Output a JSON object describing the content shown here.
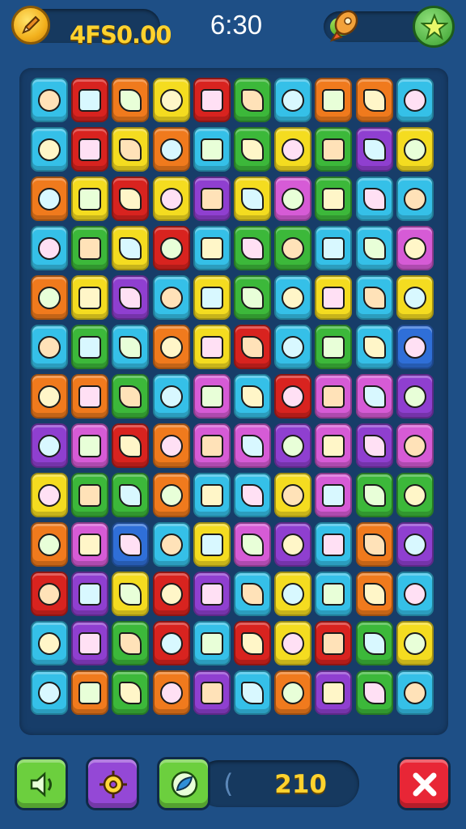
{
  "hud": {
    "coins": "4FS0.00",
    "timer": "6:30",
    "energy_level": 0.22,
    "score": "210"
  },
  "colors": {
    "background": "#1e4f86",
    "board": "#173d69",
    "gold": "#ffd22e"
  },
  "icons": {
    "coin": "pencil-coin-icon",
    "energy": "rocket-icon",
    "bonus": "star-icon",
    "sound": "speaker-icon",
    "settings": "gear-icon",
    "hint": "leaf-icon",
    "close": "close-icon"
  },
  "board": {
    "rows": [
      [
        "#35c0e8",
        "#d8231f",
        "#f07a1d",
        "#f4dc20",
        "#d8231f",
        "#3cb83a",
        "#35c0e8",
        "#f07a1d",
        "#f07a1d",
        "#35c0e8"
      ],
      [
        "#35c0e8",
        "#d8231f",
        "#f4dc20",
        "#f07a1d",
        "#35c0e8",
        "#3cb83a",
        "#f4dc20",
        "#3cb83a",
        "#8f3fd0",
        "#f4dc20"
      ],
      [
        "#f07a1d",
        "#f4dc20",
        "#d8231f",
        "#f4dc20",
        "#8f3fd0",
        "#f4dc20",
        "#d65bd6",
        "#3cb83a",
        "#35c0e8",
        "#35c0e8"
      ],
      [
        "#35c0e8",
        "#3cb83a",
        "#f4dc20",
        "#d8231f",
        "#35c0e8",
        "#3cb83a",
        "#3cb83a",
        "#35c0e8",
        "#35c0e8",
        "#d65bd6"
      ],
      [
        "#f07a1d",
        "#f4dc20",
        "#8f3fd0",
        "#35c0e8",
        "#f4dc20",
        "#3cb83a",
        "#35c0e8",
        "#f4dc20",
        "#35c0e8",
        "#f4dc20"
      ],
      [
        "#35c0e8",
        "#3cb83a",
        "#35c0e8",
        "#f07a1d",
        "#f4dc20",
        "#d8231f",
        "#35c0e8",
        "#3cb83a",
        "#35c0e8",
        "#2f6fd8"
      ],
      [
        "#f07a1d",
        "#f07a1d",
        "#3cb83a",
        "#35c0e8",
        "#d65bd6",
        "#35c0e8",
        "#d8231f",
        "#d65bd6",
        "#d65bd6",
        "#8f3fd0"
      ],
      [
        "#8f3fd0",
        "#d65bd6",
        "#d8231f",
        "#f07a1d",
        "#d65bd6",
        "#d65bd6",
        "#8f3fd0",
        "#d65bd6",
        "#8f3fd0",
        "#d65bd6"
      ],
      [
        "#f4dc20",
        "#3cb83a",
        "#3cb83a",
        "#f07a1d",
        "#35c0e8",
        "#35c0e8",
        "#f4dc20",
        "#d65bd6",
        "#3cb83a",
        "#3cb83a"
      ],
      [
        "#f07a1d",
        "#d65bd6",
        "#2f6fd8",
        "#35c0e8",
        "#f4dc20",
        "#d65bd6",
        "#8f3fd0",
        "#35c0e8",
        "#f07a1d",
        "#8f3fd0"
      ],
      [
        "#d8231f",
        "#8f3fd0",
        "#f4dc20",
        "#d8231f",
        "#8f3fd0",
        "#35c0e8",
        "#f4dc20",
        "#35c0e8",
        "#f07a1d",
        "#35c0e8"
      ],
      [
        "#35c0e8",
        "#8f3fd0",
        "#3cb83a",
        "#d8231f",
        "#35c0e8",
        "#d8231f",
        "#f4dc20",
        "#d8231f",
        "#3cb83a",
        "#f4dc20"
      ],
      [
        "#35c0e8",
        "#f07a1d",
        "#3cb83a",
        "#f07a1d",
        "#8f3fd0",
        "#35c0e8",
        "#f07a1d",
        "#8f3fd0",
        "#3cb83a",
        "#35c0e8"
      ]
    ]
  }
}
